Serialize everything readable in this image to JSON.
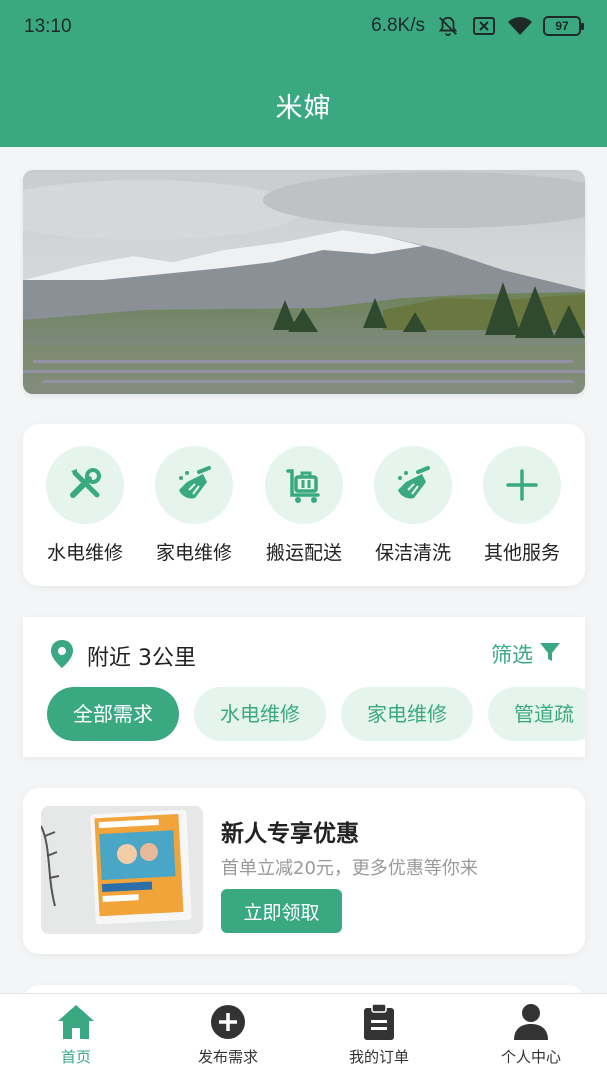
{
  "status_bar": {
    "time": "13:10",
    "network_speed": "6.8K/s",
    "battery": "97",
    "icons": [
      "mute-bell-icon",
      "sim-x-icon",
      "wifi-icon",
      "battery-icon"
    ]
  },
  "header": {
    "title": "米婶"
  },
  "banner": {
    "image": "mountain-landscape-photo"
  },
  "services": [
    {
      "label": "水电维修",
      "icon": "wrench-screwdriver-icon"
    },
    {
      "label": "家电维修",
      "icon": "cleaning-broom-icon"
    },
    {
      "label": "搬运配送",
      "icon": "luggage-cart-icon"
    },
    {
      "label": "保洁清洗",
      "icon": "cleaning-broom-icon"
    },
    {
      "label": "其他服务",
      "icon": "plus-icon"
    }
  ],
  "nearby": {
    "location_text": "附近 3公里",
    "filter_label": "筛选",
    "chips": [
      "全部需求",
      "水电维修",
      "家电维修",
      "管道疏"
    ],
    "active_chip": "全部需求"
  },
  "promo": {
    "title": "新人专享优惠",
    "subtitle": "首单立减20元，更多优惠等你来",
    "button_label": "立即领取"
  },
  "tabbar": {
    "tabs": [
      {
        "label": "首页",
        "icon": "home-icon",
        "active": true
      },
      {
        "label": "发布需求",
        "icon": "plus-circle-icon",
        "active": false
      },
      {
        "label": "我的订单",
        "icon": "clipboard-icon",
        "active": false
      },
      {
        "label": "个人中心",
        "icon": "person-icon",
        "active": false
      }
    ]
  },
  "colors": {
    "primary": "#3aa982",
    "primary_light": "#e6f4ee",
    "background": "#f3f5f7"
  }
}
